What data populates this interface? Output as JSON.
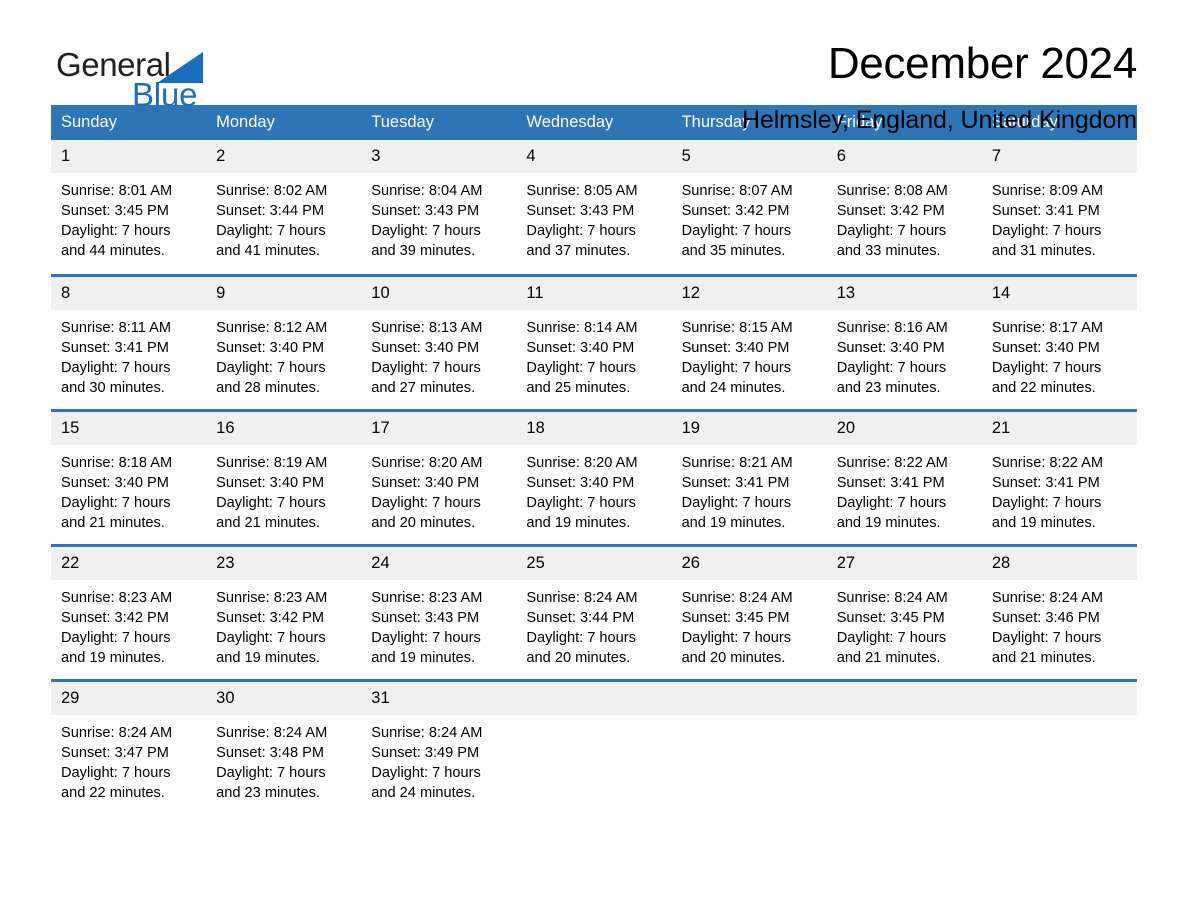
{
  "brand": {
    "name_part1": "General",
    "name_part2": "Blue",
    "logo_icon": "triangle-logo-icon",
    "blue": "#1a6ec0"
  },
  "header": {
    "month_title": "December 2024",
    "location": "Helmsley, England, United Kingdom"
  },
  "colors": {
    "header_blue": "#2e75b6",
    "daynum_gray": "#f0f0f0",
    "text": "#000000"
  },
  "calendar": {
    "weekday_headers": [
      "Sunday",
      "Monday",
      "Tuesday",
      "Wednesday",
      "Thursday",
      "Friday",
      "Saturday"
    ],
    "weeks": [
      [
        {
          "day": "1",
          "sunrise": "Sunrise: 8:01 AM",
          "sunset": "Sunset: 3:45 PM",
          "daylight": "Daylight: 7 hours and 44 minutes.",
          "details": "Sunrise: 8:01 AM\nSunset: 3:45 PM\nDaylight: 7 hours\nand 44 minutes."
        },
        {
          "day": "2",
          "sunrise": "Sunrise: 8:02 AM",
          "sunset": "Sunset: 3:44 PM",
          "daylight": "Daylight: 7 hours and 41 minutes.",
          "details": "Sunrise: 8:02 AM\nSunset: 3:44 PM\nDaylight: 7 hours\nand 41 minutes."
        },
        {
          "day": "3",
          "sunrise": "Sunrise: 8:04 AM",
          "sunset": "Sunset: 3:43 PM",
          "daylight": "Daylight: 7 hours and 39 minutes.",
          "details": "Sunrise: 8:04 AM\nSunset: 3:43 PM\nDaylight: 7 hours\nand 39 minutes."
        },
        {
          "day": "4",
          "sunrise": "Sunrise: 8:05 AM",
          "sunset": "Sunset: 3:43 PM",
          "daylight": "Daylight: 7 hours and 37 minutes.",
          "details": "Sunrise: 8:05 AM\nSunset: 3:43 PM\nDaylight: 7 hours\nand 37 minutes."
        },
        {
          "day": "5",
          "sunrise": "Sunrise: 8:07 AM",
          "sunset": "Sunset: 3:42 PM",
          "daylight": "Daylight: 7 hours and 35 minutes.",
          "details": "Sunrise: 8:07 AM\nSunset: 3:42 PM\nDaylight: 7 hours\nand 35 minutes."
        },
        {
          "day": "6",
          "sunrise": "Sunrise: 8:08 AM",
          "sunset": "Sunset: 3:42 PM",
          "daylight": "Daylight: 7 hours and 33 minutes.",
          "details": "Sunrise: 8:08 AM\nSunset: 3:42 PM\nDaylight: 7 hours\nand 33 minutes."
        },
        {
          "day": "7",
          "sunrise": "Sunrise: 8:09 AM",
          "sunset": "Sunset: 3:41 PM",
          "daylight": "Daylight: 7 hours and 31 minutes.",
          "details": "Sunrise: 8:09 AM\nSunset: 3:41 PM\nDaylight: 7 hours\nand 31 minutes."
        }
      ],
      [
        {
          "day": "8",
          "sunrise": "Sunrise: 8:11 AM",
          "sunset": "Sunset: 3:41 PM",
          "daylight": "Daylight: 7 hours and 30 minutes.",
          "details": "Sunrise: 8:11 AM\nSunset: 3:41 PM\nDaylight: 7 hours\nand 30 minutes."
        },
        {
          "day": "9",
          "sunrise": "Sunrise: 8:12 AM",
          "sunset": "Sunset: 3:40 PM",
          "daylight": "Daylight: 7 hours and 28 minutes.",
          "details": "Sunrise: 8:12 AM\nSunset: 3:40 PM\nDaylight: 7 hours\nand 28 minutes."
        },
        {
          "day": "10",
          "sunrise": "Sunrise: 8:13 AM",
          "sunset": "Sunset: 3:40 PM",
          "daylight": "Daylight: 7 hours and 27 minutes.",
          "details": "Sunrise: 8:13 AM\nSunset: 3:40 PM\nDaylight: 7 hours\nand 27 minutes."
        },
        {
          "day": "11",
          "sunrise": "Sunrise: 8:14 AM",
          "sunset": "Sunset: 3:40 PM",
          "daylight": "Daylight: 7 hours and 25 minutes.",
          "details": "Sunrise: 8:14 AM\nSunset: 3:40 PM\nDaylight: 7 hours\nand 25 minutes."
        },
        {
          "day": "12",
          "sunrise": "Sunrise: 8:15 AM",
          "sunset": "Sunset: 3:40 PM",
          "daylight": "Daylight: 7 hours and 24 minutes.",
          "details": "Sunrise: 8:15 AM\nSunset: 3:40 PM\nDaylight: 7 hours\nand 24 minutes."
        },
        {
          "day": "13",
          "sunrise": "Sunrise: 8:16 AM",
          "sunset": "Sunset: 3:40 PM",
          "daylight": "Daylight: 7 hours and 23 minutes.",
          "details": "Sunrise: 8:16 AM\nSunset: 3:40 PM\nDaylight: 7 hours\nand 23 minutes."
        },
        {
          "day": "14",
          "sunrise": "Sunrise: 8:17 AM",
          "sunset": "Sunset: 3:40 PM",
          "daylight": "Daylight: 7 hours and 22 minutes.",
          "details": "Sunrise: 8:17 AM\nSunset: 3:40 PM\nDaylight: 7 hours\nand 22 minutes."
        }
      ],
      [
        {
          "day": "15",
          "sunrise": "Sunrise: 8:18 AM",
          "sunset": "Sunset: 3:40 PM",
          "daylight": "Daylight: 7 hours and 21 minutes.",
          "details": "Sunrise: 8:18 AM\nSunset: 3:40 PM\nDaylight: 7 hours\nand 21 minutes."
        },
        {
          "day": "16",
          "sunrise": "Sunrise: 8:19 AM",
          "sunset": "Sunset: 3:40 PM",
          "daylight": "Daylight: 7 hours and 21 minutes.",
          "details": "Sunrise: 8:19 AM\nSunset: 3:40 PM\nDaylight: 7 hours\nand 21 minutes."
        },
        {
          "day": "17",
          "sunrise": "Sunrise: 8:20 AM",
          "sunset": "Sunset: 3:40 PM",
          "daylight": "Daylight: 7 hours and 20 minutes.",
          "details": "Sunrise: 8:20 AM\nSunset: 3:40 PM\nDaylight: 7 hours\nand 20 minutes."
        },
        {
          "day": "18",
          "sunrise": "Sunrise: 8:20 AM",
          "sunset": "Sunset: 3:40 PM",
          "daylight": "Daylight: 7 hours and 19 minutes.",
          "details": "Sunrise: 8:20 AM\nSunset: 3:40 PM\nDaylight: 7 hours\nand 19 minutes."
        },
        {
          "day": "19",
          "sunrise": "Sunrise: 8:21 AM",
          "sunset": "Sunset: 3:41 PM",
          "daylight": "Daylight: 7 hours and 19 minutes.",
          "details": "Sunrise: 8:21 AM\nSunset: 3:41 PM\nDaylight: 7 hours\nand 19 minutes."
        },
        {
          "day": "20",
          "sunrise": "Sunrise: 8:22 AM",
          "sunset": "Sunset: 3:41 PM",
          "daylight": "Daylight: 7 hours and 19 minutes.",
          "details": "Sunrise: 8:22 AM\nSunset: 3:41 PM\nDaylight: 7 hours\nand 19 minutes."
        },
        {
          "day": "21",
          "sunrise": "Sunrise: 8:22 AM",
          "sunset": "Sunset: 3:41 PM",
          "daylight": "Daylight: 7 hours and 19 minutes.",
          "details": "Sunrise: 8:22 AM\nSunset: 3:41 PM\nDaylight: 7 hours\nand 19 minutes."
        }
      ],
      [
        {
          "day": "22",
          "sunrise": "Sunrise: 8:23 AM",
          "sunset": "Sunset: 3:42 PM",
          "daylight": "Daylight: 7 hours and 19 minutes.",
          "details": "Sunrise: 8:23 AM\nSunset: 3:42 PM\nDaylight: 7 hours\nand 19 minutes."
        },
        {
          "day": "23",
          "sunrise": "Sunrise: 8:23 AM",
          "sunset": "Sunset: 3:42 PM",
          "daylight": "Daylight: 7 hours and 19 minutes.",
          "details": "Sunrise: 8:23 AM\nSunset: 3:42 PM\nDaylight: 7 hours\nand 19 minutes."
        },
        {
          "day": "24",
          "sunrise": "Sunrise: 8:23 AM",
          "sunset": "Sunset: 3:43 PM",
          "daylight": "Daylight: 7 hours and 19 minutes.",
          "details": "Sunrise: 8:23 AM\nSunset: 3:43 PM\nDaylight: 7 hours\nand 19 minutes."
        },
        {
          "day": "25",
          "sunrise": "Sunrise: 8:24 AM",
          "sunset": "Sunset: 3:44 PM",
          "daylight": "Daylight: 7 hours and 20 minutes.",
          "details": "Sunrise: 8:24 AM\nSunset: 3:44 PM\nDaylight: 7 hours\nand 20 minutes."
        },
        {
          "day": "26",
          "sunrise": "Sunrise: 8:24 AM",
          "sunset": "Sunset: 3:45 PM",
          "daylight": "Daylight: 7 hours and 20 minutes.",
          "details": "Sunrise: 8:24 AM\nSunset: 3:45 PM\nDaylight: 7 hours\nand 20 minutes."
        },
        {
          "day": "27",
          "sunrise": "Sunrise: 8:24 AM",
          "sunset": "Sunset: 3:45 PM",
          "daylight": "Daylight: 7 hours and 21 minutes.",
          "details": "Sunrise: 8:24 AM\nSunset: 3:45 PM\nDaylight: 7 hours\nand 21 minutes."
        },
        {
          "day": "28",
          "sunrise": "Sunrise: 8:24 AM",
          "sunset": "Sunset: 3:46 PM",
          "daylight": "Daylight: 7 hours and 21 minutes.",
          "details": "Sunrise: 8:24 AM\nSunset: 3:46 PM\nDaylight: 7 hours\nand 21 minutes."
        }
      ],
      [
        {
          "day": "29",
          "sunrise": "Sunrise: 8:24 AM",
          "sunset": "Sunset: 3:47 PM",
          "daylight": "Daylight: 7 hours and 22 minutes.",
          "details": "Sunrise: 8:24 AM\nSunset: 3:47 PM\nDaylight: 7 hours\nand 22 minutes."
        },
        {
          "day": "30",
          "sunrise": "Sunrise: 8:24 AM",
          "sunset": "Sunset: 3:48 PM",
          "daylight": "Daylight: 7 hours and 23 minutes.",
          "details": "Sunrise: 8:24 AM\nSunset: 3:48 PM\nDaylight: 7 hours\nand 23 minutes."
        },
        {
          "day": "31",
          "sunrise": "Sunrise: 8:24 AM",
          "sunset": "Sunset: 3:49 PM",
          "daylight": "Daylight: 7 hours and 24 minutes.",
          "details": "Sunrise: 8:24 AM\nSunset: 3:49 PM\nDaylight: 7 hours\nand 24 minutes."
        },
        {
          "day": "",
          "details": ""
        },
        {
          "day": "",
          "details": ""
        },
        {
          "day": "",
          "details": ""
        },
        {
          "day": "",
          "details": ""
        }
      ]
    ]
  }
}
